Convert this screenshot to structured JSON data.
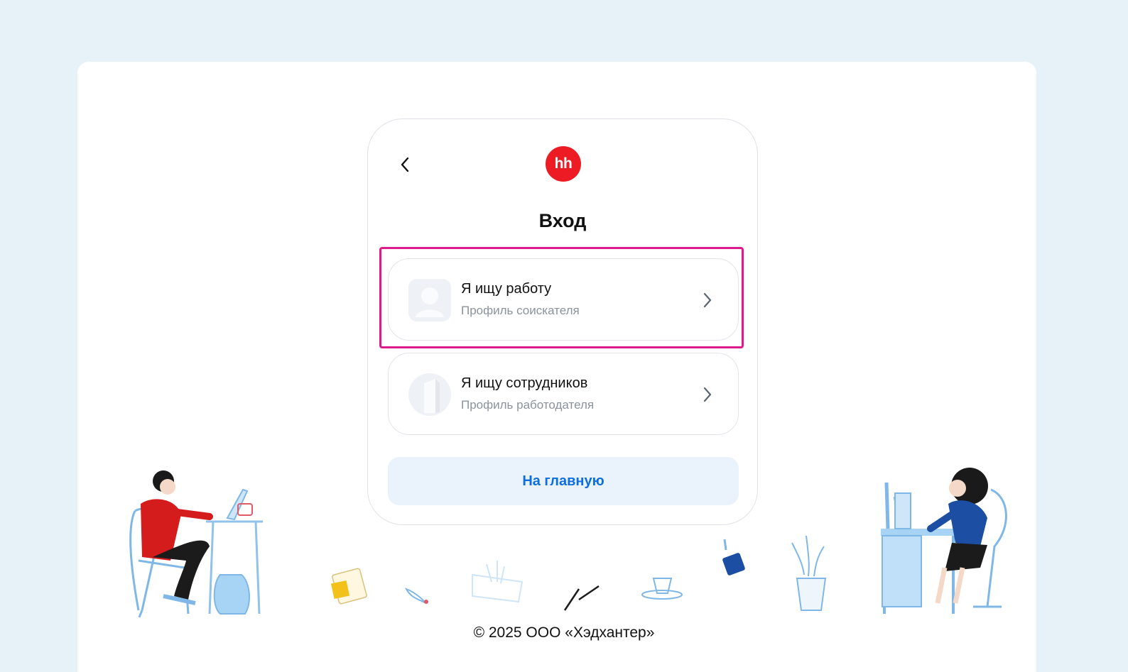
{
  "header": {
    "logo_text": "hh",
    "title": "Вход"
  },
  "options": [
    {
      "title": "Я ищу работу",
      "subtitle": "Профиль соискателя",
      "icon": "user-avatar-icon"
    },
    {
      "title": "Я ищу сотрудников",
      "subtitle": "Профиль работодателя",
      "icon": "building-icon"
    }
  ],
  "home_button": {
    "label": "На главную"
  },
  "footer": {
    "copyright": "© 2025 ООО «Хэдхантер»"
  },
  "colors": {
    "brand_red": "#ed1c24",
    "link_blue": "#0d6ee0",
    "highlight": "#dd1a8c",
    "page_bg": "#e6f1f8"
  }
}
